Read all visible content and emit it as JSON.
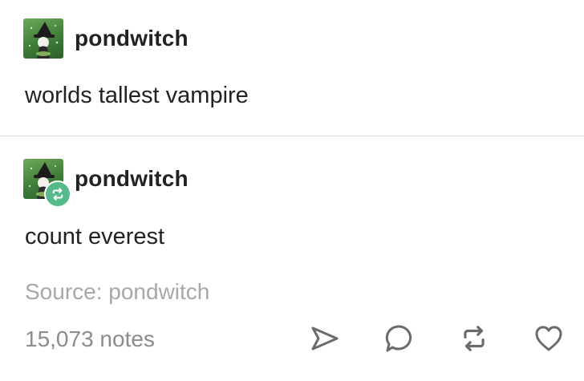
{
  "post": {
    "username": "pondwitch",
    "text": "worlds tallest vampire"
  },
  "reblog": {
    "username": "pondwitch",
    "text": "count everest"
  },
  "source": {
    "text": "Source: pondwitch"
  },
  "footer": {
    "notes": "15,073 notes",
    "icons": [
      "share-icon",
      "reply-icon",
      "reblog-icon",
      "like-icon"
    ]
  },
  "colors": {
    "reblog_badge": "#56bb8a",
    "muted_text": "#a8a8a8",
    "notes_text": "#8c8c8c"
  }
}
